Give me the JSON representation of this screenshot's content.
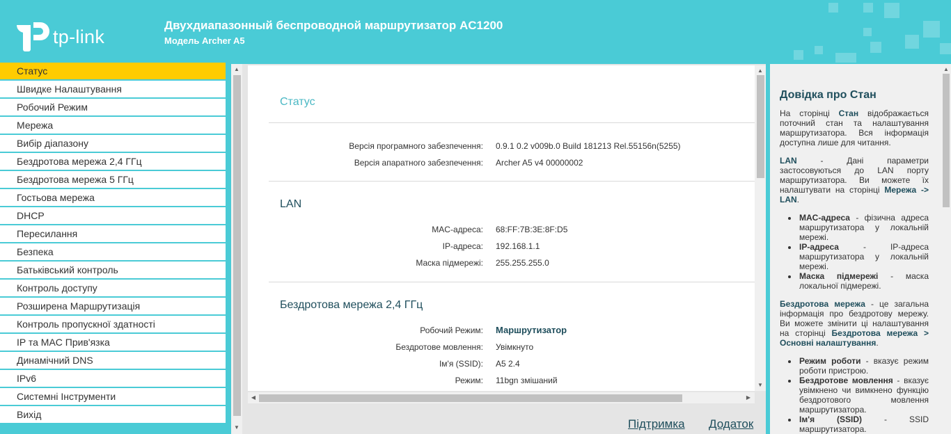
{
  "header": {
    "logo_text": "tp-link",
    "title": "Двухдиапазонный беспроводной маршрутизатор AC1200",
    "model": "Модель Archer A5"
  },
  "sidebar": {
    "items": [
      {
        "label": "Статус",
        "active": true
      },
      {
        "label": "Швидке Налаштування"
      },
      {
        "label": "Робочий Режим"
      },
      {
        "label": "Мережа"
      },
      {
        "label": "Вибір діапазону"
      },
      {
        "label": "Бездротова мережа 2,4 ГГц"
      },
      {
        "label": "Бездротова мережа 5 ГГц"
      },
      {
        "label": "Гостьова мережа"
      },
      {
        "label": "DHCP"
      },
      {
        "label": "Пересилання"
      },
      {
        "label": "Безпека"
      },
      {
        "label": "Батьківський контроль"
      },
      {
        "label": "Контроль доступу"
      },
      {
        "label": "Розширена Маршрутизація"
      },
      {
        "label": "Контроль пропускної здатності"
      },
      {
        "label": "IP та MAC Прив'язка"
      },
      {
        "label": "Динамічний DNS"
      },
      {
        "label": "IPv6"
      },
      {
        "label": "Системні Інструменти"
      },
      {
        "label": "Вихід"
      }
    ]
  },
  "main": {
    "status_title": "Статус",
    "firmware_label": "Версія програмного забезпечення:",
    "firmware_value": "0.9.1 0.2 v009b.0 Build 181213 Rel.55156n(5255)",
    "hardware_label": "Версія апаратного забезпечення:",
    "hardware_value": "Archer A5 v4 00000002",
    "lan_title": "LAN",
    "mac_label": "MAC-адреса:",
    "mac_value": "68:FF:7B:3E:8F:D5",
    "ip_label": "IP-адреса:",
    "ip_value": "192.168.1.1",
    "mask_label": "Маска підмережі:",
    "mask_value": "255.255.255.0",
    "wireless_title": "Бездротова мережа 2,4 ГГц",
    "mode_label": "Робочий Режим:",
    "mode_value": "Маршрутизатор",
    "broadcast_label": "Бездротове мовлення:",
    "broadcast_value": "Увімкнуто",
    "ssid_label": "Ім'я (SSID):",
    "ssid_value": "A5 2.4",
    "wmode_label": "Режим:",
    "wmode_value": "11bgn змішаний"
  },
  "footer": {
    "support": "Підтримка",
    "app": "Додаток"
  },
  "help": {
    "title": "Довідка про Стан",
    "p1_a": "На сторінці ",
    "p1_b": "Стан",
    "p1_c": " відображається поточний стан та налаштування маршрутизатора. Вся інформація доступна лише для читання.",
    "lan_a": "LAN",
    "lan_b": " - Дані параметри застосовуються до LAN порту маршрутизатора. Ви можете їх налаштувати на сторінці ",
    "lan_c": "Мережа -> LAN",
    "lan_d": ".",
    "li1_a": "MAC-адреса",
    "li1_b": " - фізична адреса маршрутизатора у локальній мережі.",
    "li2_a": "IP-адреса",
    "li2_b": " - IP-адреса маршрутизатора у локальній мережі.",
    "li3_a": "Маска підмережі",
    "li3_b": " - маска локальної підмережі.",
    "wl_a": "Бездротова мережа",
    "wl_b": " - це загальна інформація про бездротову мережу. Ви можете змінити ці налаштування на сторінці ",
    "wl_c": "Бездротова мережа > Основні налаштування",
    "wl_d": ".",
    "li4_a": "Режим роботи",
    "li4_b": " - вказує режим роботи пристрою.",
    "li5_a": "Бездротове мовлення",
    "li5_b": " - вказує увімкнено чи вимкнено функцію бездротового мовлення маршрутизатора.",
    "li6_a": "Ім'я (SSID)",
    "li6_b": " - SSID маршрутизатора."
  },
  "colors": {
    "brand_teal": "#4acbd6",
    "active_item": "#ffcc00",
    "dark_title": "#1f4e5c"
  }
}
